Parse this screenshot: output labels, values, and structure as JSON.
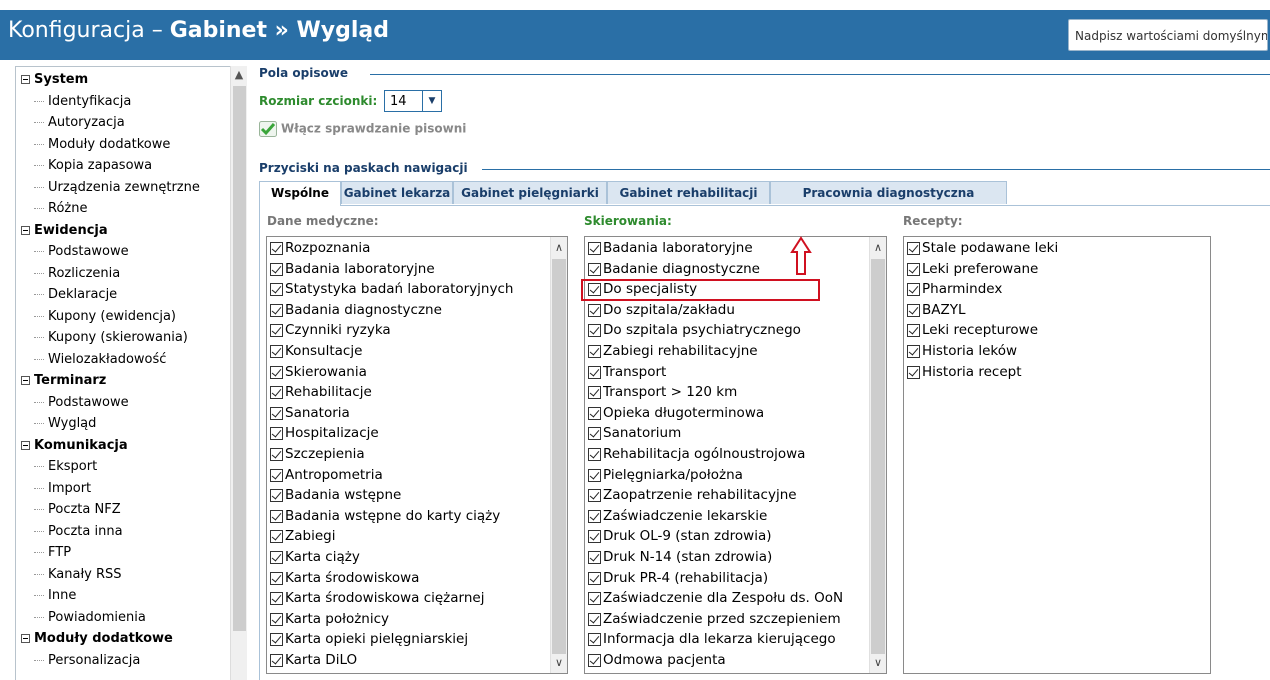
{
  "header": {
    "title_prefix": "Konfiguracja – ",
    "title_bold": "Gabinet » Wygląd",
    "override_button": "Nadpisz wartościami domyślnymi"
  },
  "tree": {
    "groups": [
      {
        "label": "System",
        "children": [
          "Identyfikacja",
          "Autoryzacja",
          "Moduły dodatkowe",
          "Kopia zapasowa",
          "Urządzenia zewnętrzne",
          "Różne"
        ]
      },
      {
        "label": "Ewidencja",
        "children": [
          "Podstawowe",
          "Rozliczenia",
          "Deklaracje",
          "Kupony (ewidencja)",
          "Kupony (skierowania)",
          "Wielozakładowość"
        ]
      },
      {
        "label": "Terminarz",
        "children": [
          "Podstawowe",
          "Wygląd"
        ]
      },
      {
        "label": "Komunikacja",
        "children": [
          "Eksport",
          "Import",
          "Poczta NFZ",
          "Poczta inna",
          "FTP",
          "Kanały RSS",
          "Inne",
          "Powiadomienia"
        ]
      },
      {
        "label": "Moduły dodatkowe",
        "children": [
          "Personalizacja"
        ]
      }
    ]
  },
  "pola": {
    "section_title": "Pola opisowe",
    "font_label": "Rozmiar czcionki:",
    "font_value": "14",
    "spell_label": "Włącz sprawdzanie pisowni"
  },
  "nav": {
    "section_title": "Przyciski na paskach nawigacji",
    "tabs": [
      "Wspólne",
      "Gabinet lekarza",
      "Gabinet pielęgniarki",
      "Gabinet rehabilitacji",
      "Pracownia diagnostyczna"
    ]
  },
  "lists": {
    "medyczne": {
      "title": "Dane medyczne:",
      "items": [
        "Rozpoznania",
        "Badania laboratoryjne",
        "Statystyka badań laboratoryjnych",
        "Badania diagnostyczne",
        "Czynniki ryzyka",
        "Konsultacje",
        "Skierowania",
        "Rehabilitacje",
        "Sanatoria",
        "Hospitalizacje",
        "Szczepienia",
        "Antropometria",
        "Badania wstępne",
        "Badania wstępne do karty ciąży",
        "Zabiegi",
        "Karta ciąży",
        "Karta środowiskowa",
        "Karta środowiskowa ciężarnej",
        "Karta położnicy",
        "Karta opieki pielęgniarskiej",
        "Karta DiLO"
      ]
    },
    "skierowania": {
      "title": "Skierowania:",
      "items": [
        "Badania laboratoryjne",
        "Badanie diagnostyczne",
        "Do specjalisty",
        "Do szpitala/zakładu",
        "Do szpitala psychiatrycznego",
        "Zabiegi rehabilitacyjne",
        "Transport",
        "Transport > 120 km",
        "Opieka długoterminowa",
        "Sanatorium",
        "Rehabilitacja ogólnoustrojowa",
        "Pielęgniarka/położna",
        "Zaopatrzenie rehabilitacyjne",
        "Zaświadczenie lekarskie",
        "Druk OL-9 (stan zdrowia)",
        "Druk N-14 (stan zdrowia)",
        "Druk PR-4 (rehabilitacja)",
        "Zaświadczenie dla Zespołu ds. OoN",
        "Zaświadczenie przed szczepieniem",
        "Informacja dla lekarza kierującego",
        "Odmowa pacjenta"
      ]
    },
    "recepty": {
      "title": "Recepty:",
      "items": [
        "Stale podawane leki",
        "Leki preferowane",
        "Pharmindex",
        "BAZYL",
        "Leki recepturowe",
        "Historia leków",
        "Historia recept"
      ]
    }
  },
  "colors": {
    "header": "#2a6fa6",
    "accent_green": "#2e8b2e",
    "highlight_red": "#d01020"
  }
}
